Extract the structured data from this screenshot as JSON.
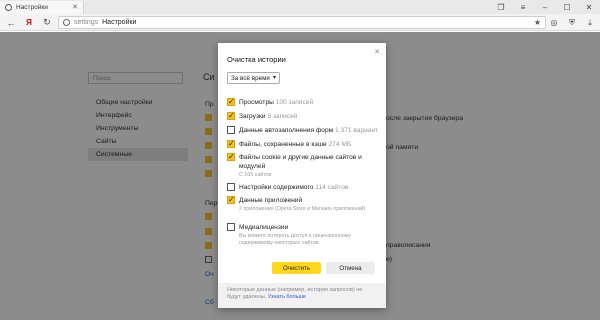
{
  "browser": {
    "tab_title": "Настройки",
    "address_host": "settings",
    "address_page": "Настройки"
  },
  "settings_page": {
    "search_placeholder": "Поиск",
    "sidebar": [
      {
        "label": "Общие настройки",
        "active": false
      },
      {
        "label": "Интерфейс",
        "active": false
      },
      {
        "label": "Инструменты",
        "active": false
      },
      {
        "label": "Сайты",
        "active": false
      },
      {
        "label": "Системные",
        "active": true
      }
    ],
    "bg_texts": {
      "heading_fragment": "Си",
      "p1": "Пр",
      "p2": "Пер",
      "close_tabs_fragment": "осле закрытия браузера",
      "memory_fragment": "ой памяти",
      "spelling_fragment": "правописания",
      "misc_fragment": "е)",
      "link1": "Оч",
      "link2": "Сб"
    }
  },
  "dialog": {
    "title": "Очистка истории",
    "period": "За всё время",
    "options": [
      {
        "label": "Просмотры",
        "count": "100 записей",
        "checked": true,
        "hint": ""
      },
      {
        "label": "Загрузки",
        "count": "8 записей",
        "checked": true,
        "hint": ""
      },
      {
        "label": "Данные автозаполнения форм",
        "count": "1 371 вариант",
        "checked": false,
        "hint": ""
      },
      {
        "label": "Файлы, сохраненные в кэше",
        "count": "274 МБ",
        "checked": true,
        "hint": ""
      },
      {
        "label": "Файлы cookie и другие данные сайтов и модулей",
        "count": "",
        "checked": true,
        "hint": "С 165 сайтов"
      },
      {
        "label": "Настройки содержимого",
        "count": "114 сайтов",
        "checked": false,
        "hint": ""
      },
      {
        "label": "Данные приложений",
        "count": "",
        "checked": true,
        "hint": "2 приложения (Opera Store и Магазин приложений)"
      },
      {
        "label": "Медиалицензии",
        "count": "",
        "checked": false,
        "hint": "Вы можете потерять доступ к лицензионному содержимому некоторых сайтов."
      }
    ],
    "clear_button": "Очистить",
    "cancel_button": "Отмена",
    "footer_text": "Некоторые данные (например, история запросов) не будут удалены.",
    "footer_link": "Узнать больше"
  }
}
